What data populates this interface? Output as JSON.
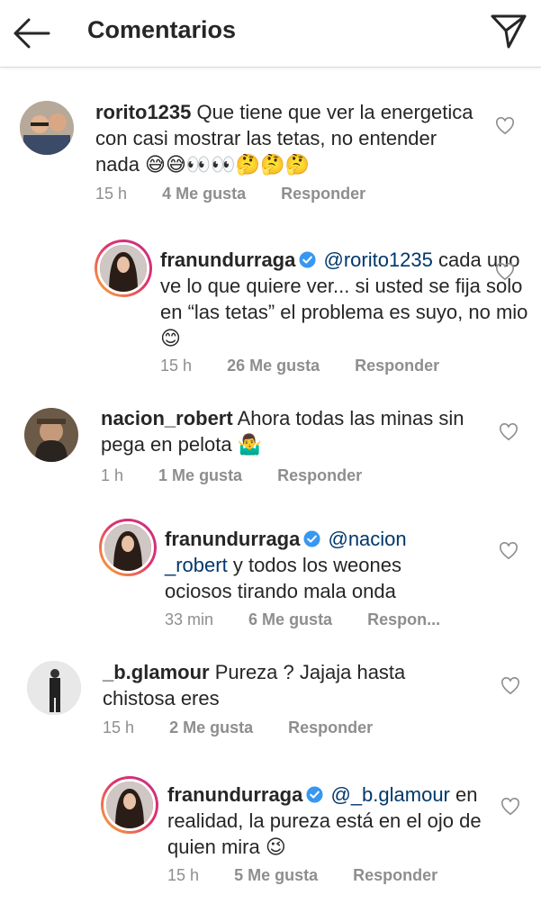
{
  "header": {
    "title": "Comentarios"
  },
  "comments": [
    {
      "username": "rorito1235",
      "text": "Que tiene que ver la energetica con casi mostrar las tetas, no entender nada 😅😅👀👀🤔🤔🤔",
      "time": "15 h",
      "likes": "4 Me gusta",
      "reply": "Responder"
    },
    {
      "username": "franundurraga",
      "mention": "@rorito1235",
      "text": "cada uno ve lo que quiere ver... si usted se fija solo en “las tetas” el problema es suyo, no mio 😊",
      "time": "15 h",
      "likes": "26 Me gusta",
      "reply": "Responder"
    },
    {
      "username": "nacion_robert",
      "text": "Ahora todas las minas sin pega en pelota 🤷‍♂️",
      "time": "1 h",
      "likes": "1 Me gusta",
      "reply": "Responder"
    },
    {
      "username": "franundurraga",
      "mention": "@nacion _robert",
      "text": "y todos los weones ociosos tirando mala onda",
      "time": "33 min",
      "likes": "6 Me gusta",
      "reply": "Respon..."
    },
    {
      "username": "_b.glamour",
      "text": "Pureza ? Jajaja hasta chistosa eres",
      "time": "15 h",
      "likes": "2 Me gusta",
      "reply": "Responder"
    },
    {
      "username": "franundurraga",
      "mention": "@_b.glamour",
      "text": "en realidad, la pureza está en el ojo de quien mira 😉",
      "time": "15 h",
      "likes": "5 Me gusta",
      "reply": "Responder"
    }
  ],
  "icons": {
    "back": "back-arrow-icon",
    "send": "paper-plane-icon",
    "like": "heart-outline-icon",
    "verified": "verified-badge-icon"
  },
  "colors": {
    "text": "#262626",
    "meta": "#8e8e8e",
    "mention": "#00376b",
    "verified": "#3897f0"
  }
}
